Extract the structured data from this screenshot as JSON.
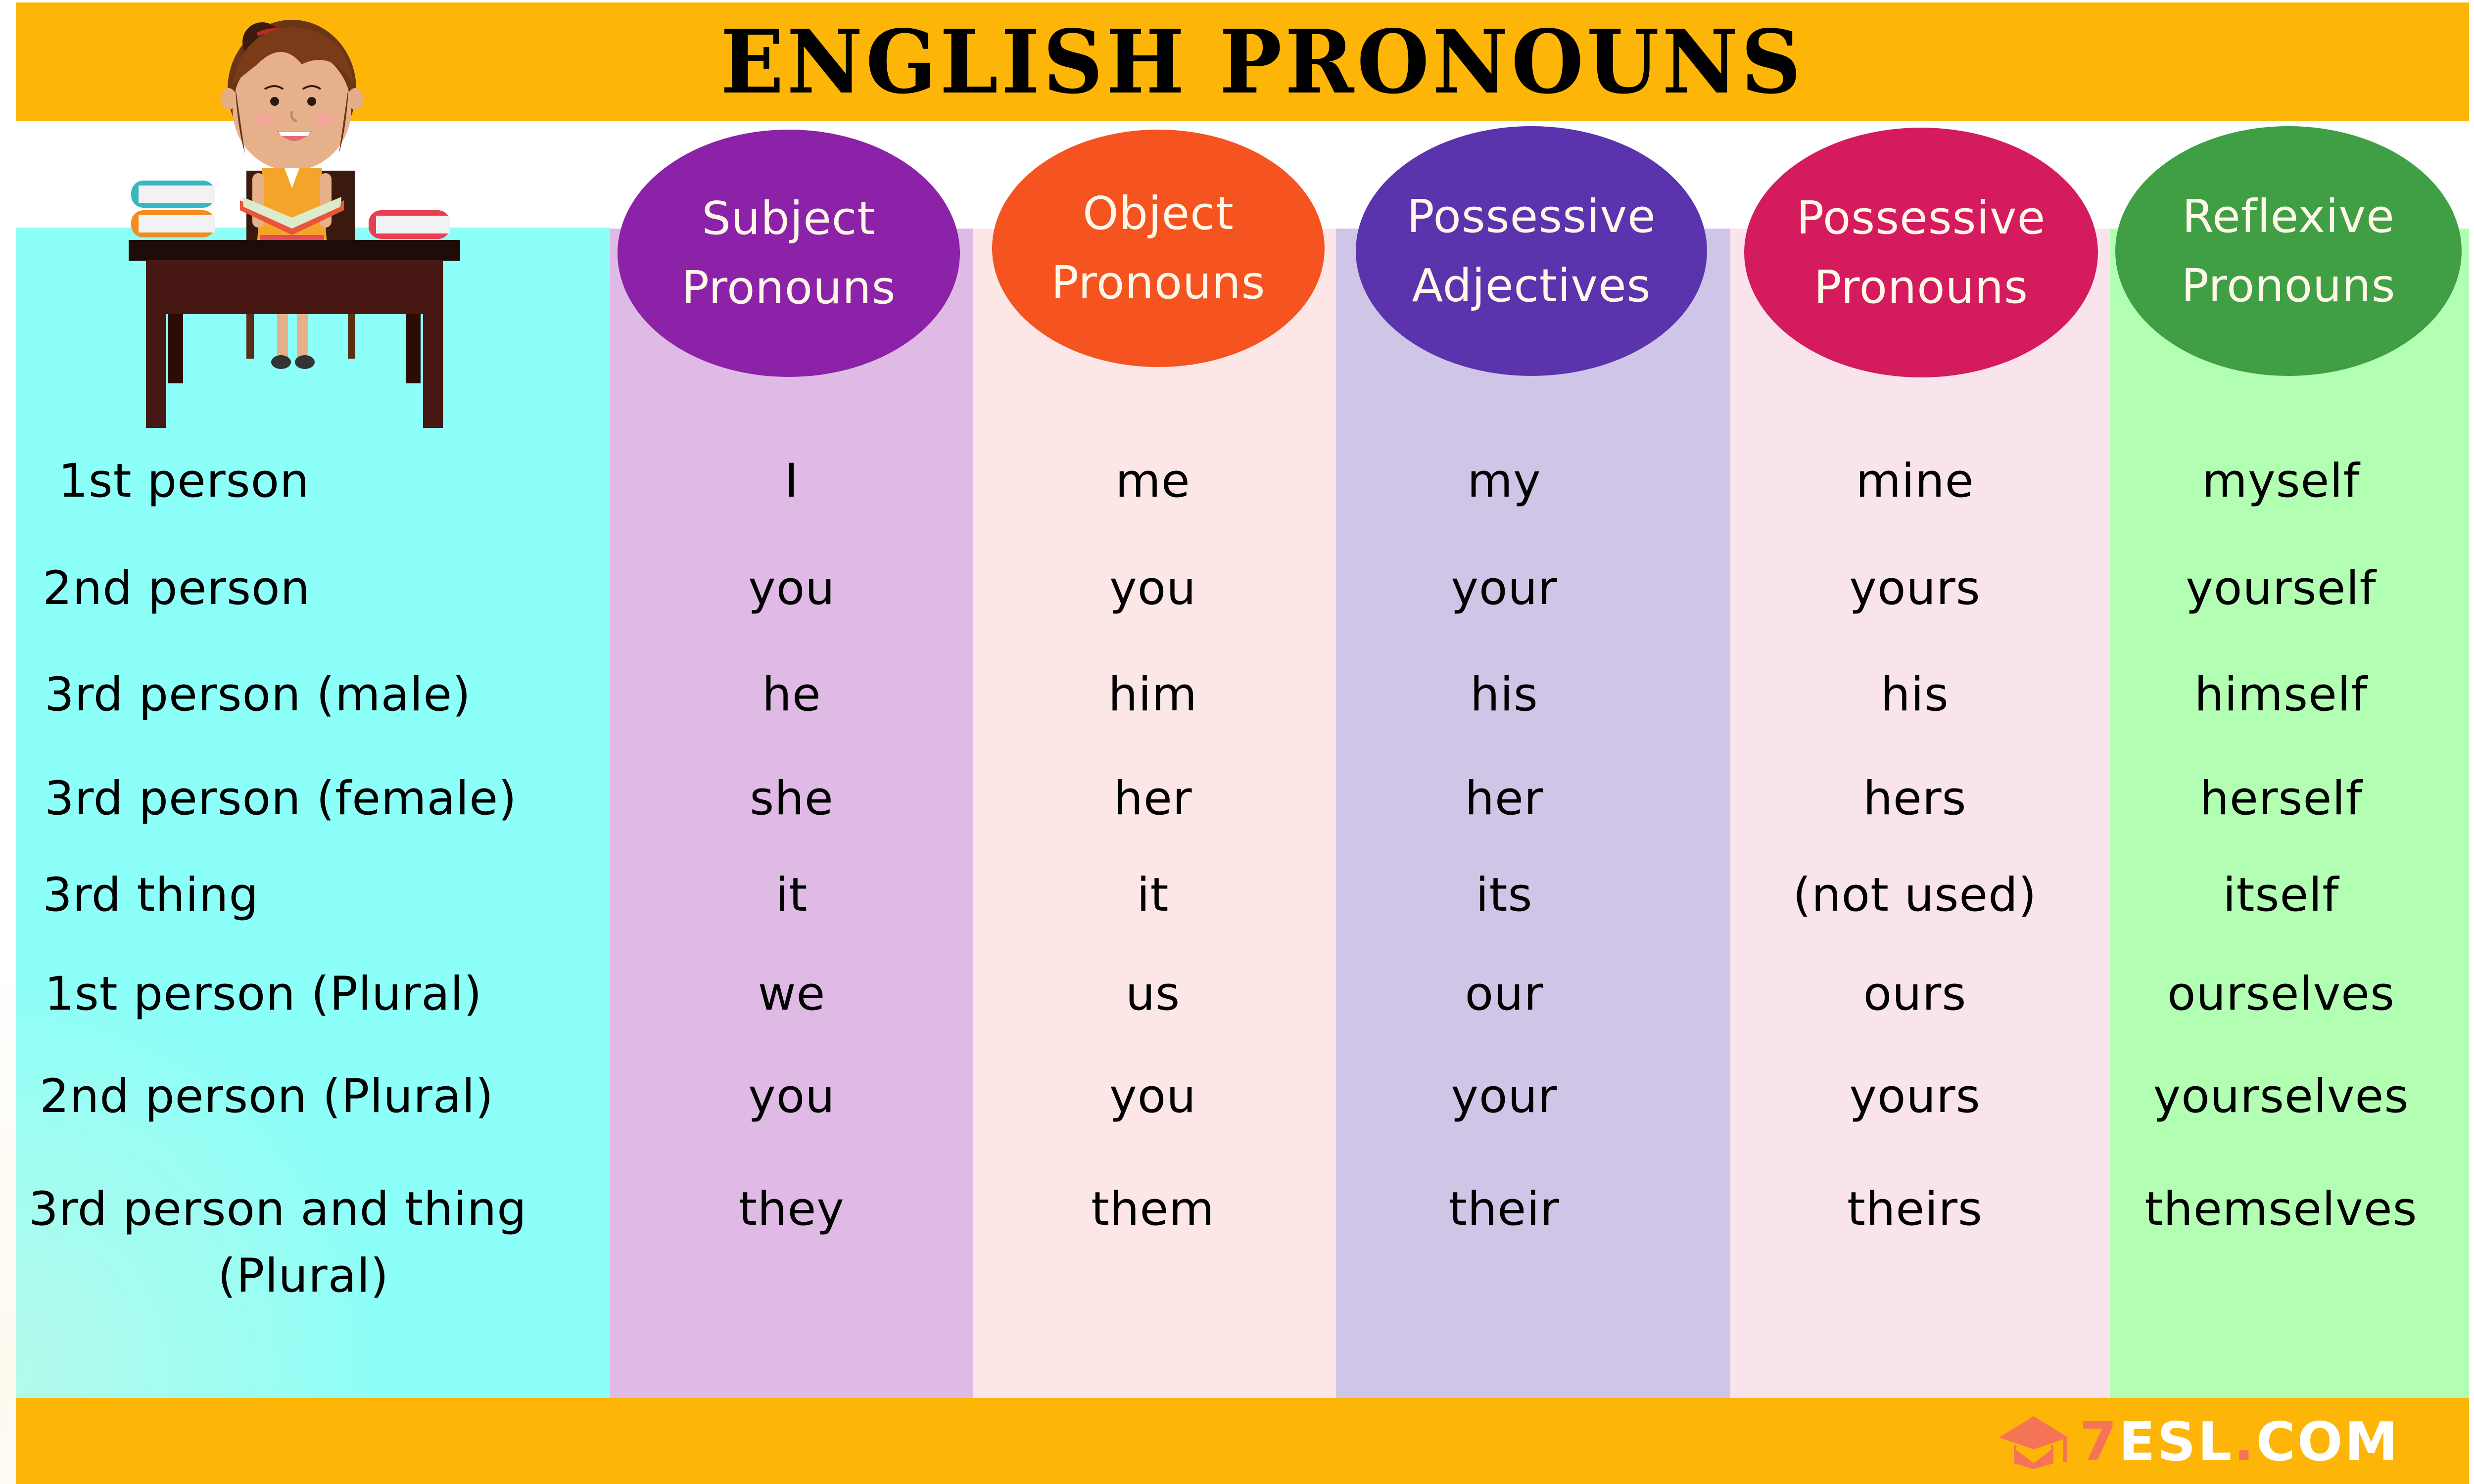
{
  "title": "ENGLISH PRONOUNS",
  "colors": {
    "banner": "#FDB508",
    "label_column": "#8BFFF8",
    "logo_accent": "#F57456"
  },
  "columns": [
    {
      "key": "subject",
      "line1": "Subject",
      "line2": "Pronouns",
      "header_color": "#8C22A8",
      "column_color": "#DEBAE4"
    },
    {
      "key": "object",
      "line1": "Object",
      "line2": "Pronouns",
      "header_color": "#F5531F",
      "column_color": "#FCE6E6"
    },
    {
      "key": "possessive_adjectives",
      "line1": "Possessive",
      "line2": "Adjectives",
      "header_color": "#5A33AD",
      "column_color": "#CFC5E6"
    },
    {
      "key": "possessive_pronouns",
      "line1": "Possessive",
      "line2": "Pronouns",
      "header_color": "#D41B5E",
      "column_color": "#FAE4EC"
    },
    {
      "key": "reflexive",
      "line1": "Reflexive",
      "line2": "Pronouns",
      "header_color": "#409F45",
      "column_color": "#B2FEB3"
    }
  ],
  "rows": [
    {
      "label": "1st person",
      "cells": [
        "I",
        "me",
        "my",
        "mine",
        "myself"
      ]
    },
    {
      "label": "2nd person",
      "cells": [
        "you",
        "you",
        "your",
        "yours",
        "yourself"
      ]
    },
    {
      "label": "3rd person (male)",
      "cells": [
        "he",
        "him",
        "his",
        "his",
        "himself"
      ]
    },
    {
      "label": "3rd person (female)",
      "cells": [
        "she",
        "her",
        "her",
        "hers",
        "herself"
      ]
    },
    {
      "label": "3rd thing",
      "cells": [
        "it",
        "it",
        "its",
        "(not used)",
        "itself"
      ]
    },
    {
      "label": "1st person (Plural)",
      "cells": [
        "we",
        "us",
        "our",
        "ours",
        "ourselves"
      ]
    },
    {
      "label": "2nd person (Plural)",
      "cells": [
        "you",
        "you",
        "your",
        "yours",
        "yourselves"
      ]
    },
    {
      "label": "3rd person and thing",
      "label_line2": "(Plural)",
      "cells": [
        "they",
        "them",
        "their",
        "theirs",
        "themselves"
      ]
    }
  ],
  "logo": {
    "icon": "graduation-cap-icon",
    "seven": "7",
    "text_part1": "ESL",
    "dot": ".",
    "text_part2": "COM"
  },
  "illustration": "teacher-at-desk-reading-book"
}
